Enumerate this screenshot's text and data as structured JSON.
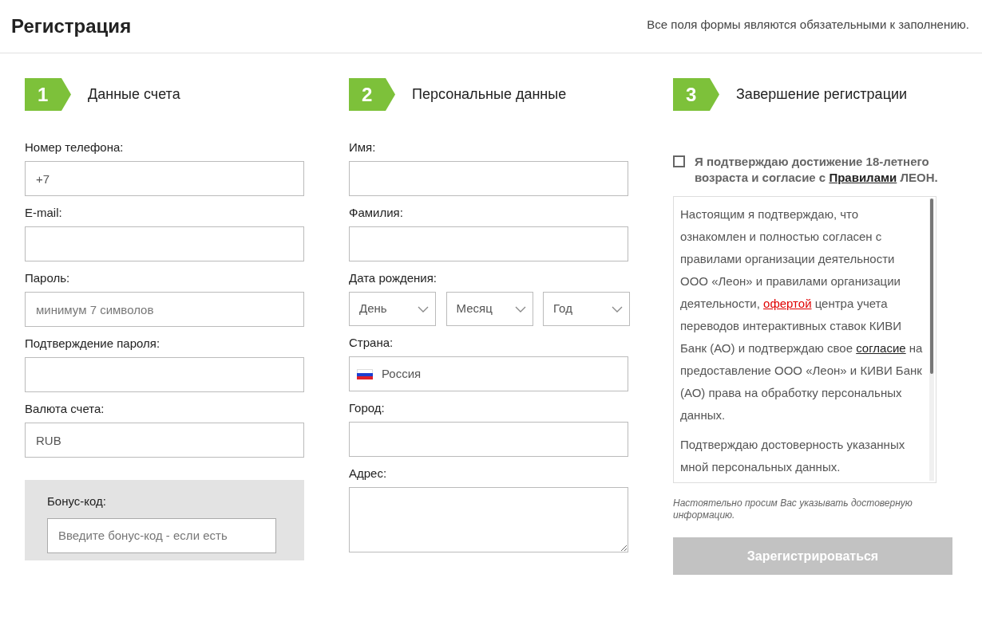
{
  "header": {
    "title": "Регистрация",
    "note": "Все поля формы являются обязательными к заполнению."
  },
  "steps": [
    {
      "number": "1",
      "title": "Данные счета",
      "fields": [
        {
          "kind": "input",
          "label": "Номер телефона:",
          "value": "+7"
        },
        {
          "kind": "input",
          "label": "E-mail:"
        },
        {
          "kind": "input",
          "label": "Пароль:",
          "placeholder": "минимум 7 символов"
        },
        {
          "kind": "input",
          "label": "Подтверждение пароля:"
        },
        {
          "kind": "input",
          "label": "Валюта счета:",
          "value": "RUB"
        }
      ],
      "bonus": {
        "label": "Бонус-код:",
        "placeholder": "Введите бонус-код - если есть"
      }
    },
    {
      "number": "2",
      "title": "Персональные данные",
      "fields": [
        {
          "kind": "input",
          "label": "Имя:"
        },
        {
          "kind": "input",
          "label": "Фамилия:"
        },
        {
          "kind": "selects",
          "label": "Дата рождения:",
          "options": [
            "День",
            "Месяц",
            "Год"
          ]
        },
        {
          "kind": "country",
          "label": "Страна:",
          "value": "Россия"
        },
        {
          "kind": "input",
          "label": "Город:"
        },
        {
          "kind": "textarea",
          "label": "Адрес:"
        }
      ]
    },
    {
      "number": "3",
      "title": "Завершение регистрации",
      "agree": {
        "checked": false,
        "segments": [
          {
            "kind": "text",
            "text": "Я подтверждаю достижение 18-летнего возраста и согласие с "
          },
          {
            "kind": "link",
            "text": "Правилами"
          },
          {
            "kind": "text",
            "text": " ЛЕОН."
          }
        ]
      },
      "terms": [
        [
          {
            "kind": "text",
            "text": "Настоящим я подтверждаю, что ознакомлен и полностью согласен с правилами организации деятельности ООО «Леон» и правилами организации деятельности, "
          },
          {
            "kind": "red-link",
            "text": "офертой"
          },
          {
            "kind": "text",
            "text": " центра учета переводов интерактивных ставок КИВИ Банк (АО) и подтверждаю свое "
          },
          {
            "kind": "link",
            "text": "согласие"
          },
          {
            "kind": "text",
            "text": " на предоставление ООО «Леон» и КИВИ Банк (АО) права на обработку персональных данных."
          }
        ],
        [
          {
            "kind": "text",
            "text": "Подтверждаю достоверность указанных мной персональных данных."
          }
        ]
      ],
      "hint": "Настоятельно просим Вас указывать достоверную информацию.",
      "submit": {
        "label": "Зарегистрироваться",
        "disabled": true
      }
    }
  ]
}
